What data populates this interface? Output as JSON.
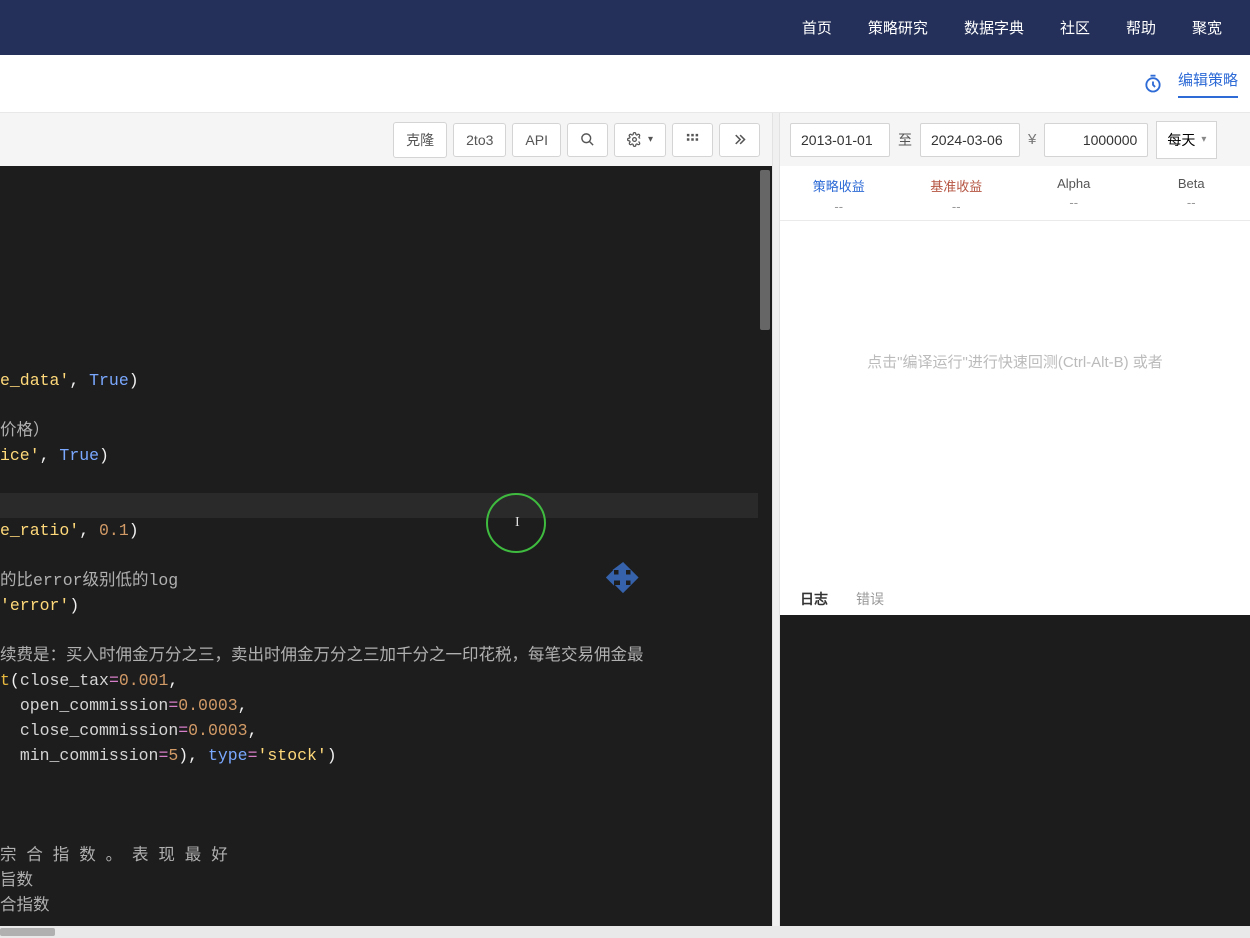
{
  "nav": {
    "items": [
      "首页",
      "策略研究",
      "数据字典",
      "社区",
      "帮助",
      "聚宽"
    ]
  },
  "subbar": {
    "edit_label": "编辑策略"
  },
  "toolbar": {
    "clone": "克隆",
    "two_to_three": "2to3",
    "api": "API"
  },
  "params": {
    "start_date": "2013-01-01",
    "date_sep": "至",
    "end_date": "2024-03-06",
    "currency_symbol": "¥",
    "capital": "1000000",
    "frequency": "每天"
  },
  "stats": {
    "strategy": {
      "label": "策略收益",
      "value": "--"
    },
    "benchmark": {
      "label": "基准收益",
      "value": "--"
    },
    "alpha": {
      "label": "Alpha",
      "value": "--"
    },
    "beta": {
      "label": "Beta",
      "value": "--"
    }
  },
  "chart_hint": "点击\"编译运行\"进行快速回测(Ctrl-Alt-B) 或者",
  "log_tabs": {
    "log": "日志",
    "error": "错误"
  },
  "code": {
    "l1": {
      "str": "e_data'",
      "bool": "True"
    },
    "l2": {
      "comment": "价格）"
    },
    "l3": {
      "str": "ice'",
      "bool": "True"
    },
    "l4": {
      "str": "e_ratio'",
      "num": "0.1"
    },
    "l5": {
      "comment": "的比error级别低的log"
    },
    "l6": {
      "str": "'error'"
    },
    "l7": {
      "comment": "续费是：买入时佣金万分之三，卖出时佣金万分之三加千分之一印花税，每笔交易佣金最"
    },
    "l8": {
      "fn": "t",
      "id": "close_tax",
      "num": "0.001"
    },
    "l9": {
      "id": "open_commission",
      "num": "0.0003"
    },
    "l10": {
      "id": "close_commission",
      "num": "0.0003"
    },
    "l11": {
      "id": "min_commission",
      "num": "5",
      "kw": "type",
      "str": "'stock'"
    },
    "l12": {
      "comment": "宗 合 指 数 。 表 现 最 好"
    },
    "l13": {
      "comment": "旨数"
    },
    "l14": {
      "comment": "合指数"
    }
  }
}
